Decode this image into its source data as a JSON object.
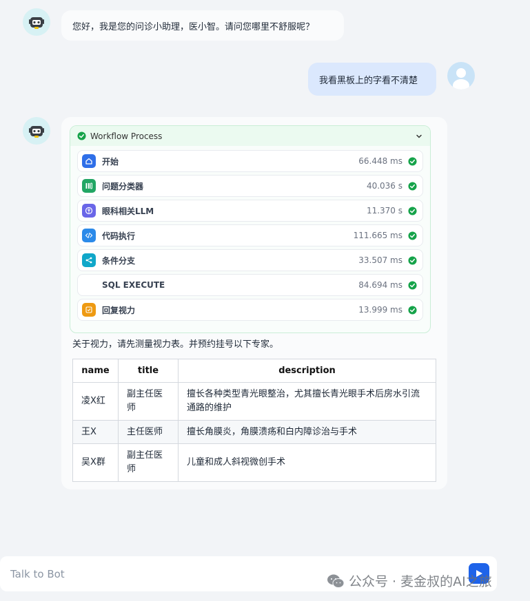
{
  "messages": {
    "greeting": "您好，我是您的问诊小助理，医小智。请问您哪里不舒服呢？",
    "user_query": "我看黑板上的字看不清楚"
  },
  "workflow": {
    "title": "Workflow Process",
    "steps": [
      {
        "label": "开始",
        "time": "66.448 ms",
        "icon": "home-icon",
        "color": "#2f6fe8"
      },
      {
        "label": "问题分类器",
        "time": "40.036 s",
        "icon": "classifier-icon",
        "color": "#22a664"
      },
      {
        "label": "眼科相关LLM",
        "time": "11.370 s",
        "icon": "llm-icon",
        "color": "#6a66e8"
      },
      {
        "label": "代码执行",
        "time": "111.665 ms",
        "icon": "code-icon",
        "color": "#2b8ae9"
      },
      {
        "label": "条件分支",
        "time": "33.507 ms",
        "icon": "branch-icon",
        "color": "#10a7c9"
      },
      {
        "label": "SQL EXECUTE",
        "time": "84.694 ms",
        "icon": "",
        "color": ""
      },
      {
        "label": "回复视力",
        "time": "13.999 ms",
        "icon": "reply-icon",
        "color": "#ee9a12"
      }
    ]
  },
  "answer": {
    "text": "关于视力，请先测量视力表。并预约挂号以下专家。",
    "table": {
      "headers": [
        "name",
        "title",
        "description"
      ],
      "rows": [
        [
          "凌X红",
          "副主任医师",
          "擅长各种类型青光眼整治，尤其擅长青光眼手术后房水引流通路的维护"
        ],
        [
          "王X",
          "主任医师",
          "擅长角膜炎，角膜溃疡和白内障诊治与手术"
        ],
        [
          "吴X群",
          "副主任医师",
          "儿童和成人斜视微创手术"
        ]
      ]
    }
  },
  "input": {
    "placeholder": "Talk to Bot"
  },
  "watermark": "公众号 · 麦金叔的AI之旅",
  "colors": {
    "success": "#16a34a",
    "send": "#1e63e9"
  }
}
